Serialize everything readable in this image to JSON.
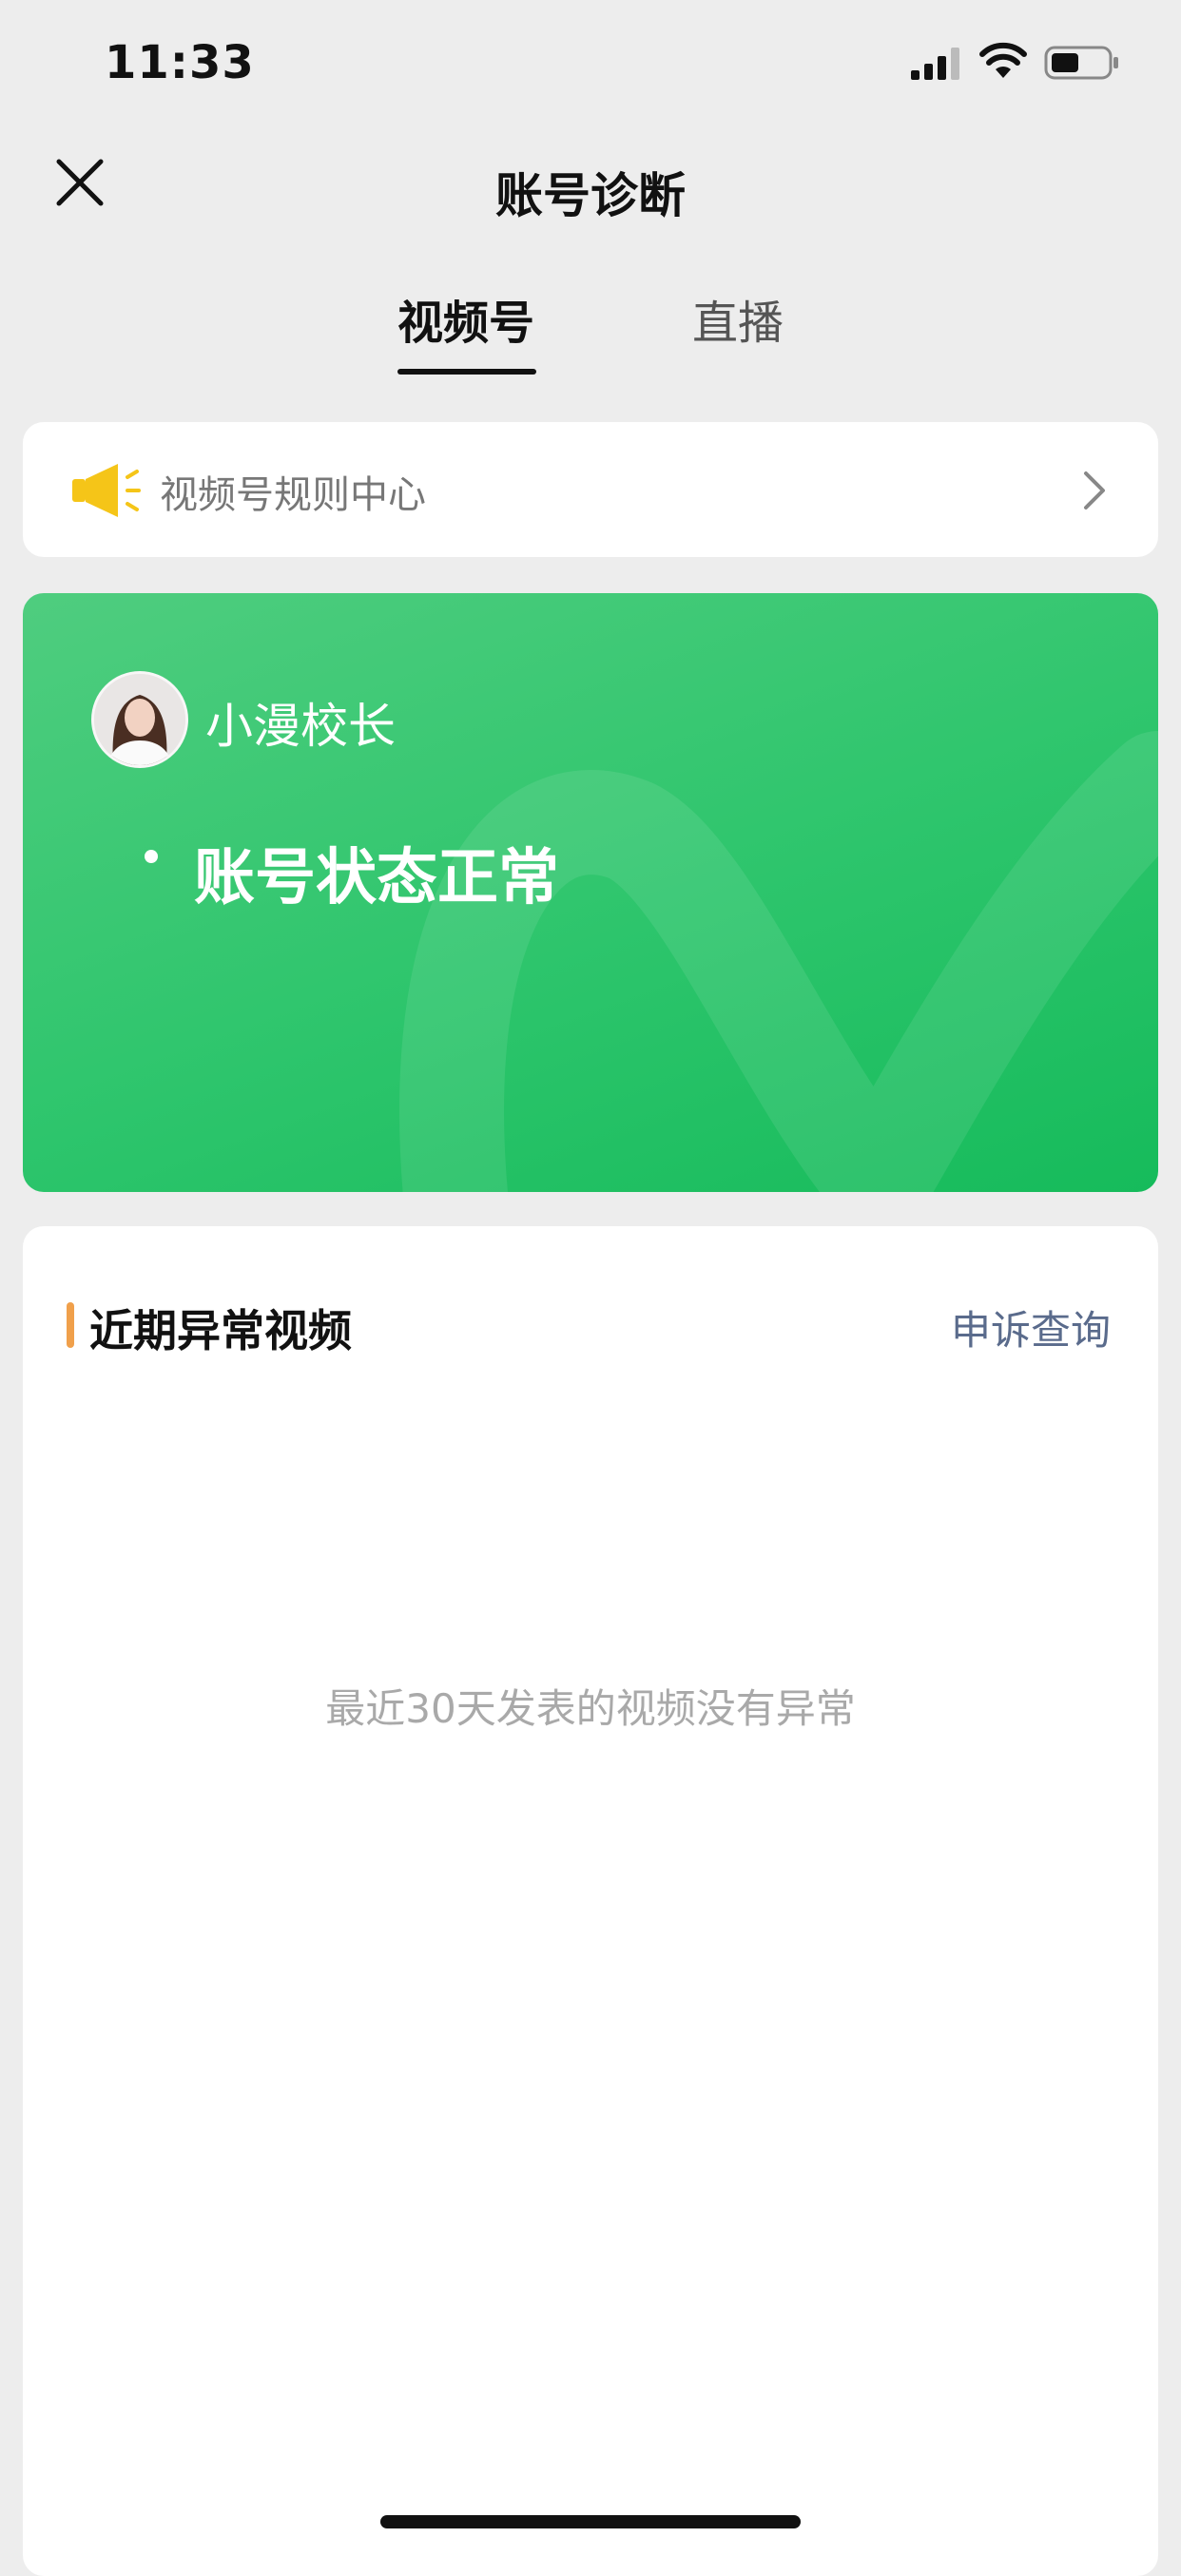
{
  "status_bar": {
    "time": "11:33"
  },
  "nav": {
    "title": "账号诊断"
  },
  "tabs": [
    {
      "label": "视频号",
      "active": true
    },
    {
      "label": "直播",
      "active": false
    }
  ],
  "rules": {
    "label": "视频号规则中心",
    "icon": "megaphone-icon"
  },
  "account": {
    "name": "小漫校长",
    "status": "账号状态正常"
  },
  "section": {
    "title": "近期异常视频",
    "appeal_link": "申诉查询",
    "empty_message": "最近30天发表的视频没有异常"
  },
  "colors": {
    "brand_green": "#2dc56c",
    "marker_orange": "#f0a04b",
    "megaphone_yellow": "#f5c518",
    "link_blue": "#5a6b8c"
  }
}
